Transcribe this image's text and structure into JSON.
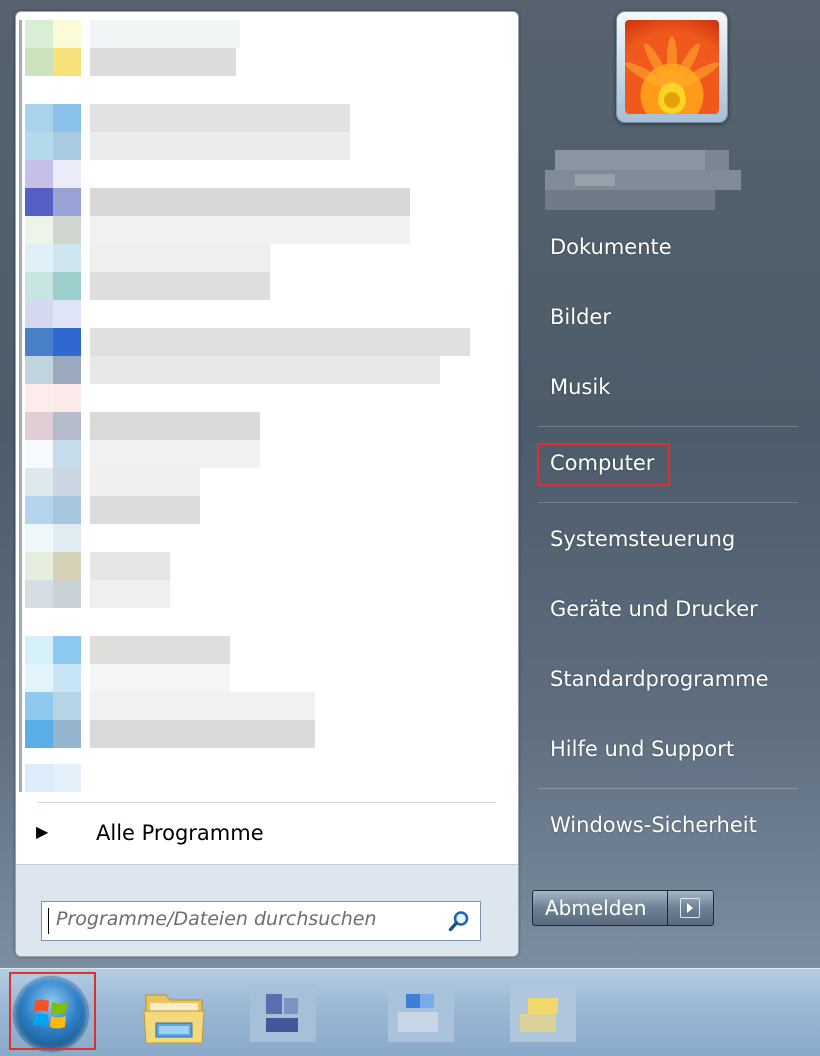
{
  "right_pane": {
    "items": [
      {
        "label": "Dokumente"
      },
      {
        "label": "Bilder"
      },
      {
        "label": "Musik"
      },
      {
        "label": "Computer"
      },
      {
        "label": "Systemsteuerung"
      },
      {
        "label": "Geräte und Drucker"
      },
      {
        "label": "Standardprogramme"
      },
      {
        "label": "Hilfe und Support"
      },
      {
        "label": "Windows-Sicherheit"
      }
    ],
    "logoff_label": "Abmelden"
  },
  "left_pane": {
    "all_programs_label": "Alle Programme",
    "search_placeholder": "Programme/Dateien durchsuchen"
  },
  "highlights": [
    "Computer",
    "start-button"
  ],
  "icons": [
    "user-picture-flower",
    "search-icon",
    "start-orb-windows-logo",
    "windows-explorer-folder-icon",
    "arrow-right-icon"
  ]
}
